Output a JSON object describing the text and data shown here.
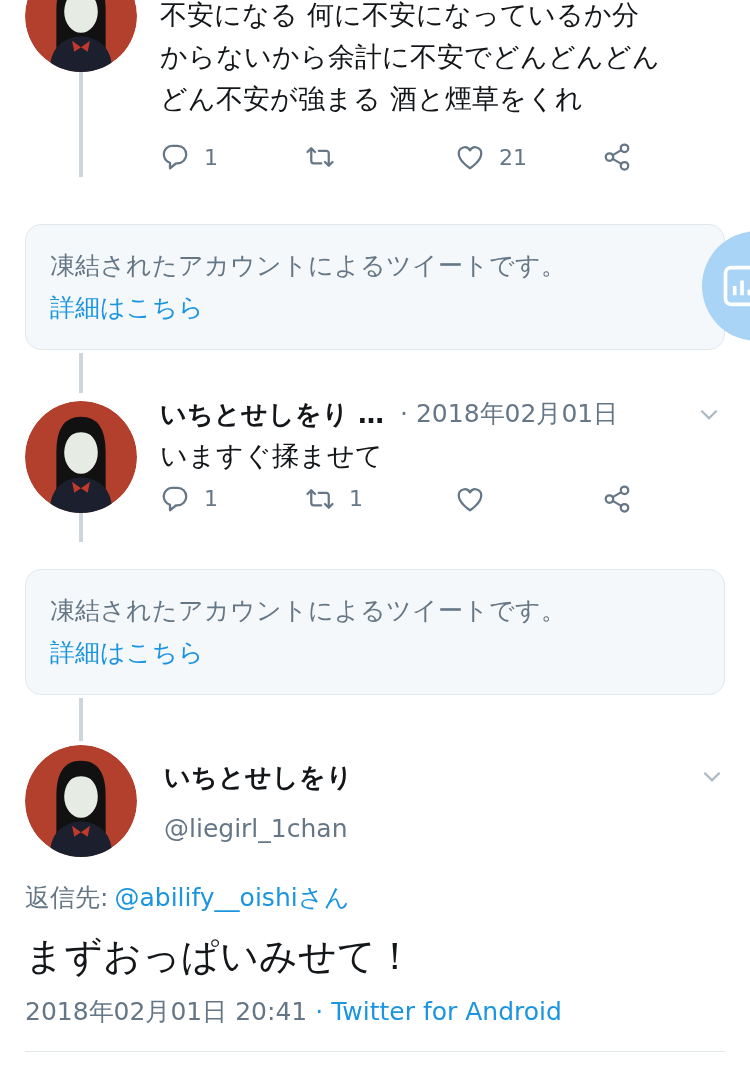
{
  "tweets": [
    {
      "kind": "partial",
      "text_lines": [
        "不安になる 何に不安になっているか分",
        "からないから余計に不安でどんどんどん",
        "どん不安が強まる 酒と煙草をくれ"
      ],
      "replies": "1",
      "likes": "21"
    },
    {
      "kind": "notice",
      "text": "凍結されたアカウントによるツイートです。",
      "link": "詳細はこちら"
    },
    {
      "kind": "reply",
      "name": "いちとせしをり …",
      "date": "· 2018年02月01日",
      "text": "いますぐ揉ませて",
      "replies": "1",
      "retweets": "1"
    },
    {
      "kind": "notice",
      "text": "凍結されたアカウントによるツイートです。",
      "link": "詳細はこちら"
    },
    {
      "kind": "main",
      "name": "いちとせしをり",
      "handle": "@liegirl_1chan",
      "reply_label": "返信先:",
      "reply_to": "@abilify__oishiさん",
      "text": "まずおっぱいみせて！",
      "timestamp": "2018年02月01日 20:41",
      "source": "· Twitter for Android"
    }
  ]
}
